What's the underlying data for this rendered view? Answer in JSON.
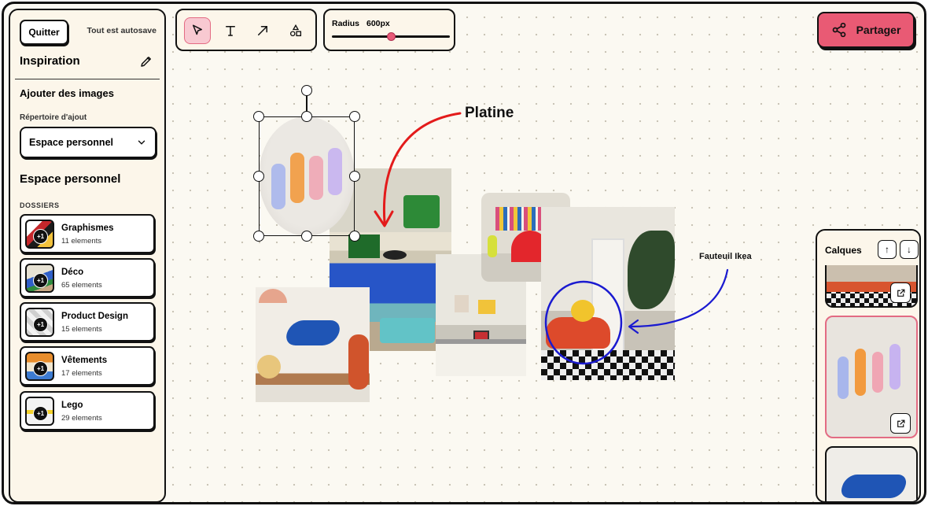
{
  "sidebar": {
    "quit_label": "Quitter",
    "autosave_label": "Tout est autosave",
    "board_title": "Inspiration",
    "add_images_label": "Ajouter des images",
    "directory_label": "Répertoire d'ajout",
    "directory_value": "Espace personnel",
    "space_title": "Espace personnel",
    "folders_label": "DOSSIERS",
    "folders": [
      {
        "name": "Graphismes",
        "count": "11 elements",
        "badge": "+1"
      },
      {
        "name": "Déco",
        "count": "65 elements",
        "badge": "+1"
      },
      {
        "name": "Product Design",
        "count": "15 elements",
        "badge": "+1"
      },
      {
        "name": "Vêtements",
        "count": "17 elements",
        "badge": "+1"
      },
      {
        "name": "Lego",
        "count": "29 elements",
        "badge": "+1"
      }
    ]
  },
  "toolbar": {
    "tools": [
      "cursor-icon",
      "text-icon",
      "arrow-icon",
      "shapes-icon"
    ],
    "active_tool": "cursor-icon"
  },
  "radius": {
    "label": "Radius",
    "value": "600px",
    "slider_fraction": 0.5
  },
  "share": {
    "label": "Partager"
  },
  "layers": {
    "title": "Calques",
    "up_label": "↑",
    "down_label": "↓"
  },
  "canvas": {
    "annotation_platine": "Platine",
    "annotation_fauteuil": "Fauteuil Ikea"
  },
  "colors": {
    "accent_pink": "#e95a74",
    "panel_bg": "#fcf6ea",
    "annotation_red": "#e31b1b",
    "annotation_blue": "#1a1ad0"
  }
}
